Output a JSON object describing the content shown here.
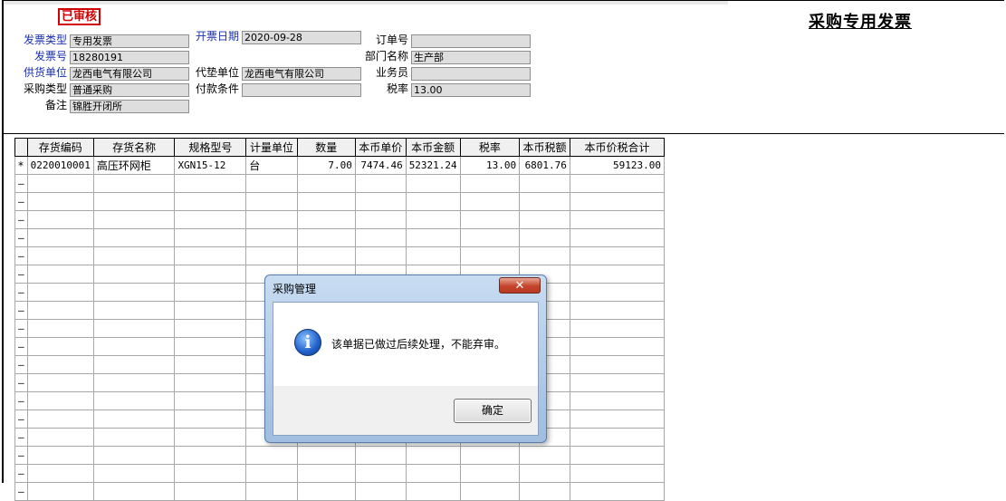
{
  "document": {
    "status_stamp": "已审核",
    "title": "采购专用发票"
  },
  "header_fields": {
    "invoice_type": {
      "label": "发票类型",
      "value": "专用发票"
    },
    "invoice_no": {
      "label": "发票号",
      "value": "18280191"
    },
    "supplier": {
      "label": "供货单位",
      "value": "龙西电气有限公司"
    },
    "purchase_type": {
      "label": "采购类型",
      "value": "普通采购"
    },
    "remark": {
      "label": "备注",
      "value": "锦胜开闭所"
    },
    "invoice_date": {
      "label": "开票日期",
      "value": "2020-09-28"
    },
    "advance_unit": {
      "label": "代垫单位",
      "value": "龙西电气有限公司"
    },
    "payment_terms": {
      "label": "付款条件",
      "value": ""
    },
    "order_no": {
      "label": "订单号",
      "value": ""
    },
    "department": {
      "label": "部门名称",
      "value": "生产部"
    },
    "salesperson": {
      "label": "业务员",
      "value": ""
    },
    "tax_rate": {
      "label": "税率",
      "value": "13.00"
    }
  },
  "grid": {
    "columns": [
      "存货编码",
      "存货名称",
      "规格型号",
      "计量单位",
      "数量",
      "本币单价",
      "本币金额",
      "税率",
      "本币税额",
      "本币价税合计"
    ],
    "rows": [
      {
        "marker": "*",
        "cells": [
          "0220010001",
          "高压环网柜",
          "XGN15-12",
          "台",
          "7.00",
          "7474.46",
          "52321.24",
          "13.00",
          "6801.76",
          "59123.00"
        ]
      }
    ]
  },
  "dialog": {
    "title": "采购管理",
    "close_glyph": "✕",
    "message": "该单据已做过后续处理，不能弃审。",
    "ok_label": "确定",
    "icon": "info-icon"
  },
  "colors": {
    "label_blue": "#1a2fb0",
    "stamp_red": "#d40000",
    "field_gray": "#dedede"
  }
}
